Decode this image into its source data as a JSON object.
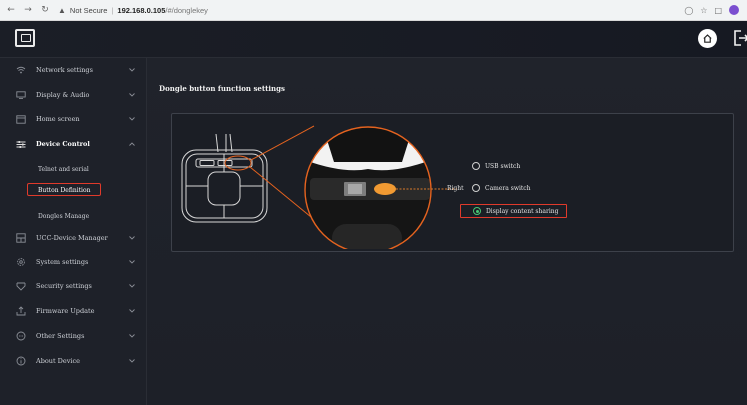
{
  "browser": {
    "back_icon": "arrow-left-icon",
    "forward_icon": "arrow-right-icon",
    "reload_icon": "reload-icon",
    "security_label": "Not Secure",
    "url_host": "192.168.0.105",
    "url_path": "/#/donglekey"
  },
  "header": {
    "logo_icon": "screen-share-logo-icon",
    "home_icon": "home-icon",
    "exit_icon": "logout-icon"
  },
  "sidebar": {
    "items": [
      {
        "label": "Network settings",
        "icon": "wifi-icon"
      },
      {
        "label": "Display & Audio",
        "icon": "monitor-icon"
      },
      {
        "label": "Home screen",
        "icon": "window-icon"
      },
      {
        "label": "Device Control",
        "icon": "sliders-icon"
      },
      {
        "label": "UCC-Device Manager",
        "icon": "device-icon"
      },
      {
        "label": "System settings",
        "icon": "gear-icon"
      },
      {
        "label": "Security settings",
        "icon": "shield-icon"
      },
      {
        "label": "Firmware Update",
        "icon": "upload-icon"
      },
      {
        "label": "Other Settings",
        "icon": "circle-dots-icon"
      },
      {
        "label": "About Device",
        "icon": "info-icon"
      }
    ],
    "sub_items": [
      {
        "label": "Telnet and serial"
      },
      {
        "label": "Button Definition"
      },
      {
        "label": "Dongles Manage"
      }
    ]
  },
  "main": {
    "title": "Dongle button function settings",
    "button_position_label": "Right",
    "options": [
      {
        "label": "USB switch",
        "selected": false
      },
      {
        "label": "Camera switch",
        "selected": false
      },
      {
        "label": "Display content sharing",
        "selected": true
      }
    ]
  },
  "colors": {
    "accent_red": "#e03a2b",
    "accent_orange": "#f0a030",
    "radio_selected": "#48c774",
    "background": "#1d2028"
  }
}
